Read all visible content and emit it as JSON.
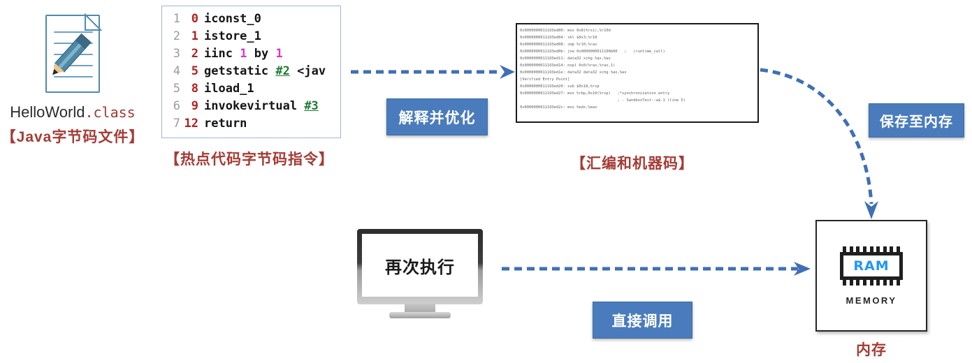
{
  "source": {
    "icon": "document-with-pencil-icon",
    "file_name": "HelloWorld",
    "file_ext": ".class",
    "caption": "【Java字节码文件】"
  },
  "bytecode": {
    "caption": "【热点代码字节码指令】",
    "lines": [
      {
        "n": "1",
        "pc": "0",
        "op": "iconst_0",
        "num": "",
        "ref": "",
        "rest": ""
      },
      {
        "n": "2",
        "pc": "1",
        "op": "istore_1",
        "num": "",
        "ref": "",
        "rest": ""
      },
      {
        "n": "3",
        "pc": "2",
        "op": "iinc",
        "num": "1",
        "ref": "",
        "rest": "by",
        "num2": "1"
      },
      {
        "n": "4",
        "pc": "5",
        "op": "getstatic",
        "num": "",
        "ref": "#2",
        "rest": "<jav"
      },
      {
        "n": "5",
        "pc": "8",
        "op": "iload_1",
        "num": "",
        "ref": "",
        "rest": ""
      },
      {
        "n": "6",
        "pc": "9",
        "op": "invokevirtual",
        "num": "",
        "ref": "#3",
        "rest": ""
      },
      {
        "n": "7",
        "pc": "12",
        "op": "return",
        "num": "",
        "ref": "",
        "rest": ""
      }
    ]
  },
  "assembly": {
    "caption": "【汇编和机器码】",
    "lines": [
      "0x00000000111O3ed00: mov 0x8(%rsi),%r10d",
      "0x00000000111O3ed04: shl $0x3,%r10",
      "0x00000000111O3ed08: cmp %r10,%rax",
      "0x00000000111O3ed0b: jne 0x0000000011100b60   ;   (runtime_call)",
      "0x00000000111O3ed11: data32 xchg %ax,%ax",
      "0x00000000111O3ed14: nopl 0x0(%rax,%rax,1)",
      "0x00000000111O3ed1e: data32 data32 xchg %ax,%ax",
      "[Verified Entry Point]",
      "0x00000000111O3ed20: sub $0x18,%rsp",
      "0x00000000111O3ed27: mov %rbp,0x10(%rsp)   ;*synchronization entry",
      "                                           ; - SandboxTest::a$-1 (line 5)",
      "0x00000000111O3ed2c: mov %edx,%eax"
    ]
  },
  "buttons": {
    "interpret": "解释并优化",
    "save_to_memory": "保存至内存",
    "direct_call": "直接调用"
  },
  "monitor": {
    "screen_text": "再次执行"
  },
  "memory": {
    "chip_label": "RAM",
    "word": "MEMORY",
    "caption": "内存"
  },
  "colors": {
    "accent_blue": "#4a7cbd",
    "arrow_blue": "#3f6fb5",
    "caption_red": "#a43c35",
    "bytecode_pc": "#b0221f",
    "bytecode_ref": "#1d7a33",
    "bytecode_num": "#d937c8",
    "ram_blue": "#2196f3"
  },
  "arrows": [
    {
      "name": "bytecode-to-assembly",
      "style": "dashed-straight-right"
    },
    {
      "name": "assembly-to-memory",
      "style": "dashed-curved-down-right"
    },
    {
      "name": "monitor-to-memory",
      "style": "dashed-straight-right"
    }
  ]
}
